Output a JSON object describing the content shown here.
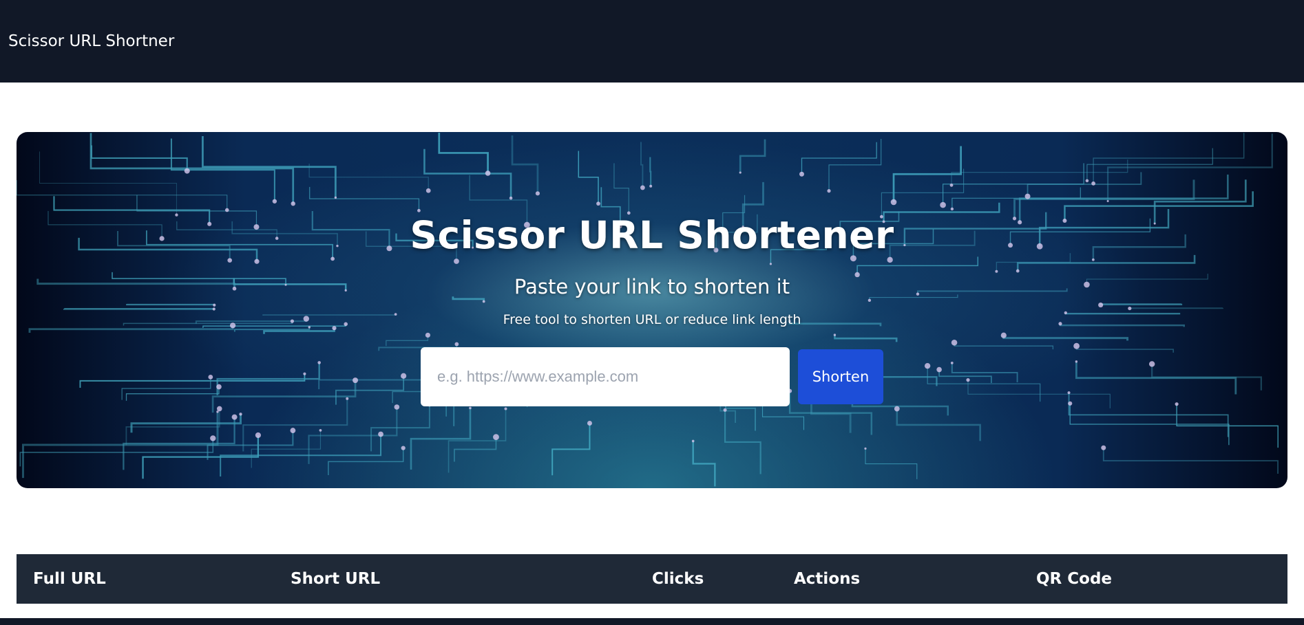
{
  "navbar": {
    "brand": "Scissor URL Shortner"
  },
  "hero": {
    "title": "Scissor URL Shortener",
    "subtitle": "Paste your link to shorten it",
    "description": "Free tool to shorten URL or reduce link length",
    "input_placeholder": "e.g. https://www.example.com",
    "input_value": "",
    "button_label": "Shorten"
  },
  "table": {
    "headers": [
      "Full URL",
      "Short URL",
      "Clicks",
      "Actions",
      "QR Code"
    ],
    "rows": []
  },
  "colors": {
    "navbar_bg": "#111827",
    "table_header_bg": "#1f2937",
    "button_bg": "#1d4ed8",
    "circuit_glow": "#5fd3e0"
  }
}
